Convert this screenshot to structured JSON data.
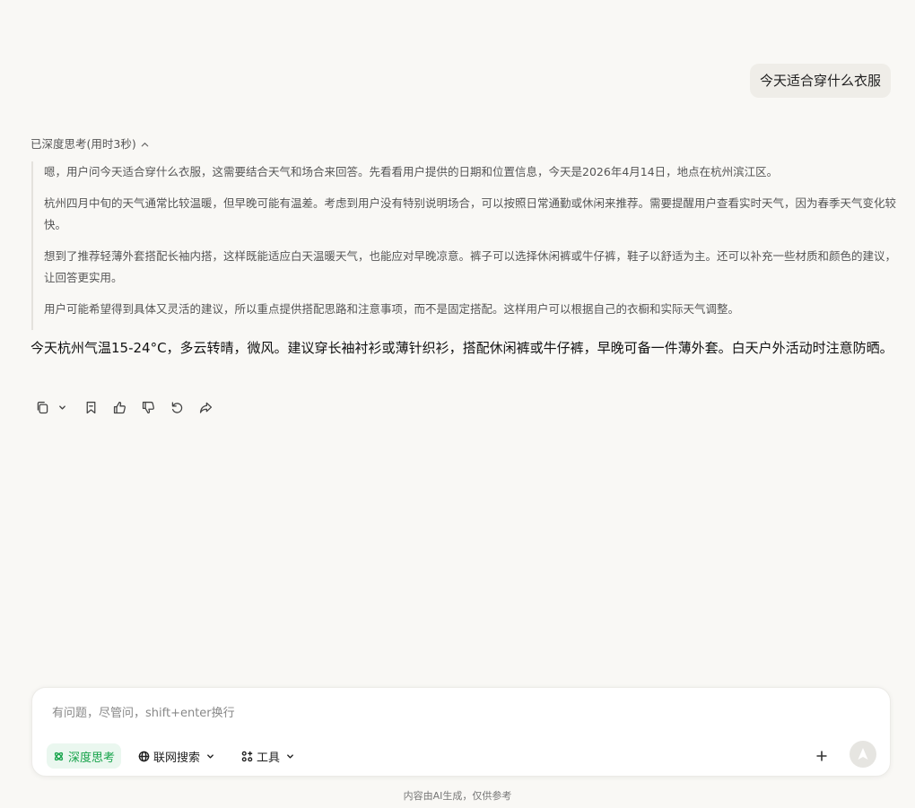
{
  "user_message": "今天适合穿什么衣服",
  "thinking": {
    "header": "已深度思考(用时3秒)",
    "paragraphs": [
      "嗯，用户问今天适合穿什么衣服，这需要结合天气和场合来回答。先看看用户提供的日期和位置信息，今天是2026年4月14日，地点在杭州滨江区。",
      "杭州四月中旬的天气通常比较温暖，但早晚可能有温差。考虑到用户没有特别说明场合，可以按照日常通勤或休闲来推荐。需要提醒用户查看实时天气，因为春季天气变化较快。",
      "想到了推荐轻薄外套搭配长袖内搭，这样既能适应白天温暖天气，也能应对早晚凉意。裤子可以选择休闲裤或牛仔裤，鞋子以舒适为主。还可以补充一些材质和颜色的建议，让回答更实用。",
      "用户可能希望得到具体又灵活的建议，所以重点提供搭配思路和注意事项，而不是固定搭配。这样用户可以根据自己的衣橱和实际天气调整。"
    ]
  },
  "answer": "今天杭州气温15-24°C，多云转晴，微风。建议穿长袖衬衫或薄针织衫，搭配休闲裤或牛仔裤，早晚可备一件薄外套。白天户外活动时注意防晒。",
  "actions": {
    "icons": [
      "copy-icon",
      "bookmark-icon",
      "thumbs-up-icon",
      "thumbs-down-icon",
      "regenerate-icon",
      "share-icon"
    ]
  },
  "composer": {
    "placeholder": "有问题，尽管问，shift+enter换行",
    "deep_think_label": "深度思考",
    "web_search_label": "联网搜索",
    "tools_label": "工具",
    "accent_color": "#16a34a"
  },
  "disclaimer": "内容由AI生成，仅供参考"
}
